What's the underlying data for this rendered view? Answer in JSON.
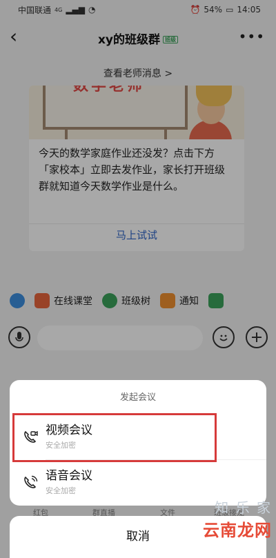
{
  "status_bar": {
    "carrier": "中国联通",
    "network": "4G",
    "battery": "54%",
    "time": "14:05"
  },
  "header": {
    "title": "xy的班级群",
    "tag": "班级"
  },
  "teacher_link": "查看老师消息 >",
  "card": {
    "image_text": "数学老师",
    "message": "今天的数学家庭作业还没发？点击下方「家校本」立即去发作业，家长打开班级群就知道今天数学作业是什么。",
    "action": "马上试试"
  },
  "toolbar": [
    {
      "label": "",
      "icon": "avatar-icon",
      "color": "#3d8fe0"
    },
    {
      "label": "在线课堂",
      "icon": "online-class-icon",
      "color": "#e8663d"
    },
    {
      "label": "班级树",
      "icon": "class-tree-icon",
      "color": "#3ca35b"
    },
    {
      "label": "通知",
      "icon": "megaphone-icon",
      "color": "#f09030"
    },
    {
      "label": "",
      "icon": "notebook-icon",
      "color": "#3ca35b"
    }
  ],
  "sheet": {
    "title": "发起会议",
    "items": [
      {
        "label": "视频会议",
        "sub": "安全加密",
        "icon": "video-call-icon"
      },
      {
        "label": "语音会议",
        "sub": "安全加密",
        "icon": "voice-call-icon"
      }
    ],
    "cancel": "取消"
  },
  "behind_labels": [
    "红包",
    "群直播",
    "文件",
    "班级接龙"
  ],
  "watermark": {
    "top": "知 乐 家",
    "bottom": "云南龙网"
  }
}
